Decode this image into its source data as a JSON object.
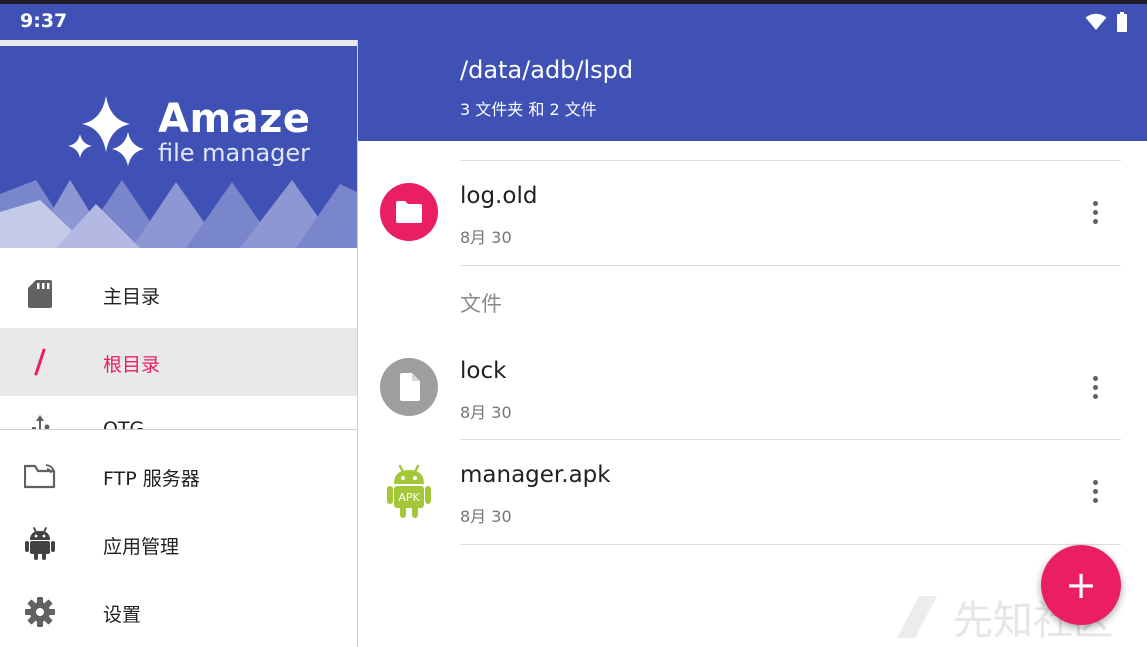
{
  "status_bar": {
    "time": "9:37"
  },
  "app_bar": {
    "path": "/data/adb/lspd",
    "summary": "3 文件夹 和 2 文件"
  },
  "drawer": {
    "brand_name": "Amaze",
    "brand_sub": "file manager",
    "items": [
      {
        "label": "主目录",
        "icon": "sd-card-icon"
      },
      {
        "label": "根目录",
        "icon": "root-slash-icon",
        "active": true
      },
      {
        "label": "OTG",
        "icon": "usb-icon"
      },
      {
        "label": "FTP 服务器",
        "icon": "ftp-folder-icon"
      },
      {
        "label": "应用管理",
        "icon": "android-icon"
      },
      {
        "label": "设置",
        "icon": "gear-icon"
      }
    ]
  },
  "list": {
    "folders": [
      {
        "name": "log.old",
        "date": "8月 30",
        "icon": "folder-icon",
        "color": "#e91e63"
      }
    ],
    "files_header": "文件",
    "files": [
      {
        "name": "lock",
        "date": "8月 30",
        "icon": "file-icon",
        "color": "#9e9e9e"
      },
      {
        "name": "manager.apk",
        "date": "8月 30",
        "icon": "apk-android-icon",
        "badge": "APK",
        "color": "#a4c639"
      }
    ]
  },
  "fab": {
    "label": "+"
  },
  "watermark": {
    "text": "先知社区"
  },
  "colors": {
    "primary": "#3f51b5",
    "accent": "#e91e63"
  }
}
